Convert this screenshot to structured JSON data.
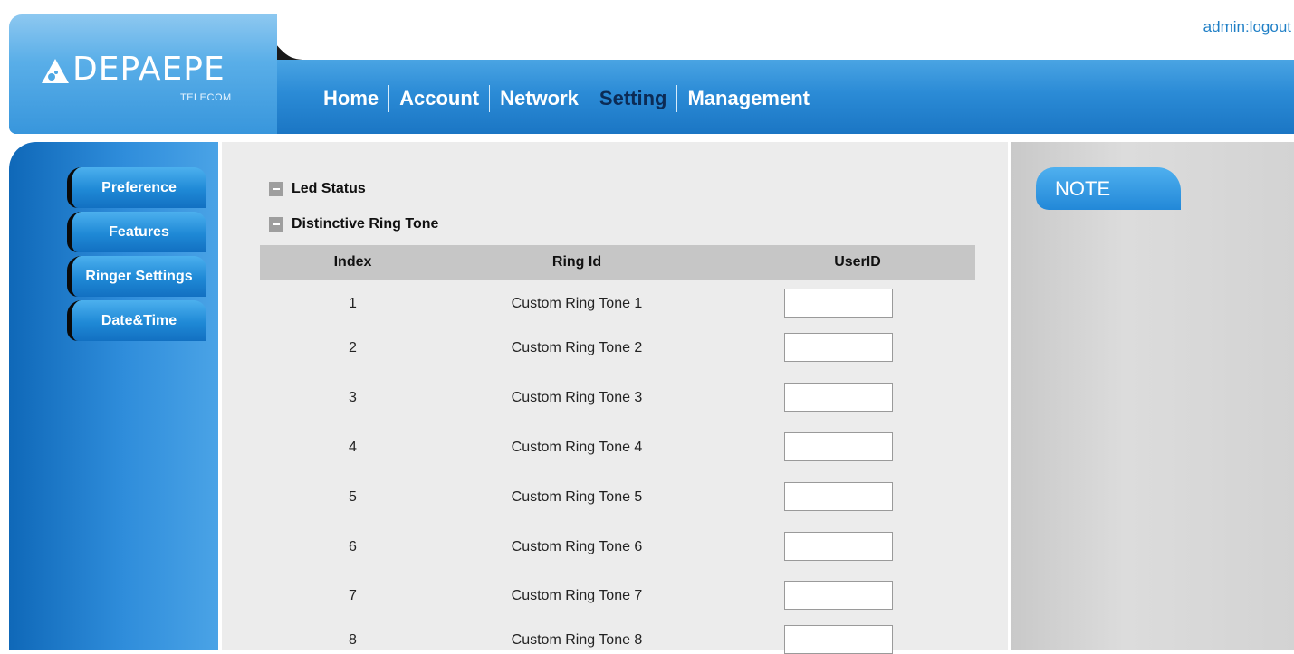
{
  "header": {
    "logout_text": "admin:logout",
    "logo": {
      "word": "DEPAEPE",
      "sub": "TELECOM"
    },
    "nav": [
      {
        "label": "Home",
        "active": false
      },
      {
        "label": "Account",
        "active": false
      },
      {
        "label": "Network",
        "active": false
      },
      {
        "label": "Setting",
        "active": true
      },
      {
        "label": "Management",
        "active": false
      }
    ]
  },
  "sidebar": {
    "items": [
      {
        "label": "Preference"
      },
      {
        "label": "Features"
      },
      {
        "label": "Ringer Settings"
      },
      {
        "label": "Date&Time"
      }
    ]
  },
  "main": {
    "sections": [
      {
        "title": "Led Status"
      },
      {
        "title": "Distinctive Ring Tone"
      }
    ],
    "table": {
      "headers": {
        "index": "Index",
        "ring_id": "Ring Id",
        "user_id": "UserID"
      },
      "rows": [
        {
          "index": "1",
          "ring_id": "Custom Ring Tone 1",
          "user_id": ""
        },
        {
          "index": "2",
          "ring_id": "Custom Ring Tone 2",
          "user_id": ""
        },
        {
          "index": "3",
          "ring_id": "Custom Ring Tone 3",
          "user_id": ""
        },
        {
          "index": "4",
          "ring_id": "Custom Ring Tone 4",
          "user_id": ""
        },
        {
          "index": "5",
          "ring_id": "Custom Ring Tone 5",
          "user_id": ""
        },
        {
          "index": "6",
          "ring_id": "Custom Ring Tone 6",
          "user_id": ""
        },
        {
          "index": "7",
          "ring_id": "Custom Ring Tone 7",
          "user_id": ""
        },
        {
          "index": "8",
          "ring_id": "Custom Ring Tone 8",
          "user_id": ""
        }
      ]
    }
  },
  "note": {
    "title": "NOTE"
  },
  "colors": {
    "brand_blue": "#2b8bd6",
    "active_nav": "#0c2b55",
    "link": "#1f7fc6",
    "table_header": "#c6c6c6",
    "main_bg": "#ececec"
  }
}
